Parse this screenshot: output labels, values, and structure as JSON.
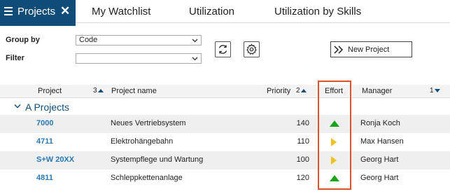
{
  "tabs": {
    "active": "Projects",
    "items": [
      "My Watchlist",
      "Utilization",
      "Utilization by Skills"
    ]
  },
  "filters": {
    "group_by_label": "Group by",
    "group_by_value": "Code",
    "filter_label": "Filter",
    "filter_value": ""
  },
  "toolbar": {
    "new_project_label": "New Project"
  },
  "grid": {
    "headers": {
      "project": "Project",
      "project_sort": "3",
      "project_name": "Project name",
      "priority": "Priority",
      "priority_sort": "2",
      "effort": "Effort",
      "manager": "Manager",
      "manager_sort": "1"
    },
    "group_label": "A Projects",
    "rows": [
      {
        "code": "7000",
        "name": "Neues Vertriebsystem",
        "priority": "140",
        "effort": "up",
        "manager": "Ronja Koch"
      },
      {
        "code": "4711",
        "name": "Elektrohängebahn",
        "priority": "110",
        "effort": "right",
        "manager": "Max Hansen"
      },
      {
        "code": "S+W 20XX",
        "name": "Systempflege und Wartung",
        "priority": "100",
        "effort": "right",
        "manager": "Georg Hart"
      },
      {
        "code": "4811",
        "name": "Schleppkettenanlage",
        "priority": "120",
        "effort": "up",
        "manager": "Georg Hart"
      }
    ]
  },
  "colors": {
    "brand": "#0f4c78",
    "link": "#2a78b5",
    "effort_up": "#1aa31a",
    "effort_right": "#f2c21b",
    "highlight": "#d9532c"
  }
}
